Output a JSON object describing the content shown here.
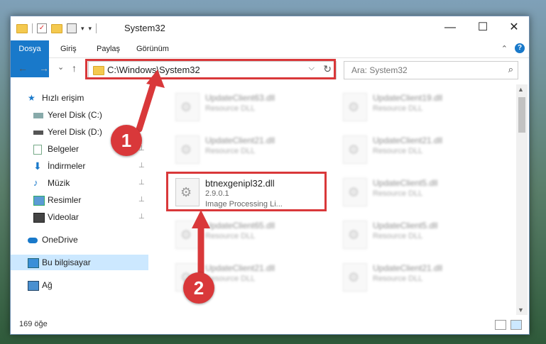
{
  "window": {
    "title": "System32",
    "minimize": "—",
    "maximize": "☐",
    "close": "✕"
  },
  "ribbon": {
    "tabs": [
      "Dosya",
      "Giriş",
      "Paylaş",
      "Görünüm"
    ],
    "collapse": "⌃",
    "help": "?"
  },
  "address": {
    "path": "C:\\Windows\\System32",
    "dropdown": "⌵",
    "refresh": "↻"
  },
  "nav": {
    "back": "←",
    "forward": "→",
    "recent": "⌄",
    "up": "↑"
  },
  "search": {
    "placeholder": "Ara: System32",
    "icon": "search-icon"
  },
  "sidebar": {
    "items": [
      {
        "label": "Hızlı erişim",
        "icon": "star-icon"
      },
      {
        "label": "Yerel Disk (C:)",
        "icon": "drive-icon"
      },
      {
        "label": "Yerel Disk (D:)",
        "icon": "drive-icon"
      },
      {
        "label": "Belgeler",
        "icon": "documents-icon"
      },
      {
        "label": "İndirmeler",
        "icon": "download-icon"
      },
      {
        "label": "Müzik",
        "icon": "music-icon"
      },
      {
        "label": "Resimler",
        "icon": "pictures-icon"
      },
      {
        "label": "Videolar",
        "icon": "video-icon"
      },
      {
        "label": "OneDrive",
        "icon": "cloud-icon"
      },
      {
        "label": "Bu bilgisayar",
        "icon": "computer-icon"
      },
      {
        "label": "Ağ",
        "icon": "network-icon"
      }
    ],
    "pin": "📌"
  },
  "files": [
    {
      "name": "UpdateClient63.dll",
      "type": "Resource DLL"
    },
    {
      "name": "UpdateClient19.dll",
      "type": "Resource DLL"
    },
    {
      "name": "UpdateClient21.dll",
      "type": "Resource DLL"
    },
    {
      "name": "UpdateClient21.dll",
      "type": "Resource DLL"
    },
    {
      "name": "btnexgenipl32.dll",
      "version": "2.9.0.1",
      "desc": "Image Processing Li..."
    },
    {
      "name": "UpdateClient5.dll",
      "type": "Resource DLL"
    },
    {
      "name": "UpdateClient65.dll",
      "type": "Resource DLL"
    },
    {
      "name": "UpdateClient5.dll",
      "type": "Resource DLL"
    },
    {
      "name": "UpdateClient21.dll",
      "type": "Resource DLL"
    },
    {
      "name": "UpdateClient21.dll",
      "type": "Resource DLL"
    }
  ],
  "status": {
    "count": "169 öğe"
  },
  "annotations": {
    "badge1": "1",
    "badge2": "2",
    "color": "#d9383a"
  }
}
